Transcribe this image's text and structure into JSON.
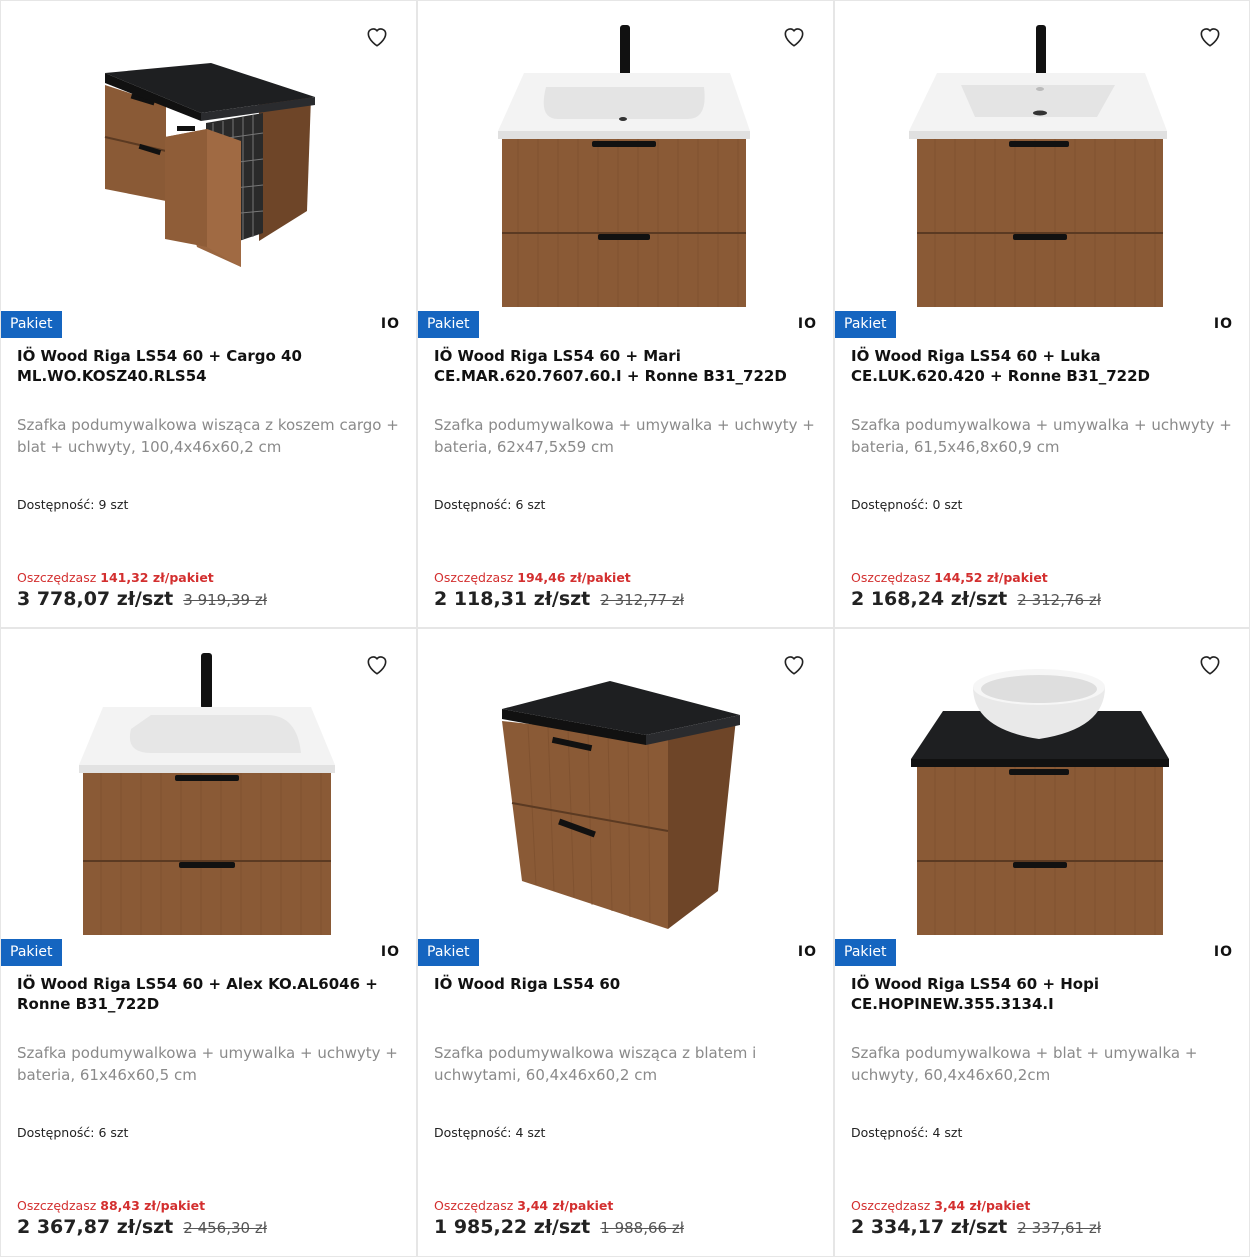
{
  "badge_label": "Pakiet",
  "brand_label": "IO",
  "availability_label": "Dostępność:",
  "save_label": "Oszczędzasz",
  "colors": {
    "badge": "#1565c0",
    "save": "#d32f2f",
    "wood": "#8a5a36",
    "countertop": "#1e1f21",
    "basin": "#f1f1f1"
  },
  "products": [
    {
      "title": "IÖ Wood Riga LS54 60 + Cargo 40 ML.WO.KOSZ40.RLS54",
      "description": "Szafka podumywalkowa wisząca z koszem cargo + blat + uchwyty, 100,4x46x60,2 cm",
      "availability": "9 szt",
      "savings": "141,32 zł/pakiet",
      "price": "3 778,07 zł/szt",
      "old_price": "3 919,39 zł",
      "image": "cabinet-cargo-image"
    },
    {
      "title": "IÖ Wood Riga LS54 60 + Mari CE.MAR.620.7607.60.I + Ronne B31_722D",
      "description": "Szafka podumywalkowa + umywalka + uchwyty + bateria, 62x47,5x59 cm",
      "availability": "6 szt",
      "savings": "194,46 zł/pakiet",
      "price": "2 118,31 zł/szt",
      "old_price": "2 312,77 zł",
      "image": "cabinet-basin-faucet-image"
    },
    {
      "title": "IÖ Wood Riga LS54 60 + Luka CE.LUK.620.420 + Ronne B31_722D",
      "description": "Szafka podumywalkowa + umywalka + uchwyty + bateria, 61,5x46,8x60,9 cm",
      "availability": "0 szt",
      "savings": "144,52 zł/pakiet",
      "price": "2 168,24 zł/szt",
      "old_price": "2 312,76 zł",
      "image": "cabinet-basin-faucet-image"
    },
    {
      "title": "IÖ Wood Riga LS54 60 + Alex KO.AL6046 + Ronne B31_722D",
      "description": "Szafka podumywalkowa + umywalka + uchwyty + bateria, 61x46x60,5 cm",
      "availability": "6 szt",
      "savings": "88,43 zł/pakiet",
      "price": "2 367,87 zł/szt",
      "old_price": "2 456,30 zł",
      "image": "cabinet-basin-faucet-image"
    },
    {
      "title": "IÖ Wood Riga LS54 60",
      "description": "Szafka podumywalkowa wisząca z blatem i uchwytami, 60,4x46x60,2 cm",
      "availability": "4 szt",
      "savings": "3,44 zł/pakiet",
      "price": "1 985,22 zł/szt",
      "old_price": "1 988,66 zł",
      "image": "cabinet-countertop-image"
    },
    {
      "title": "IÖ Wood Riga LS54 60 + Hopi CE.HOPINEW.355.3134.I",
      "description": "Szafka podumywalkowa + blat + umywalka + uchwyty, 60,4x46x60,2cm",
      "availability": "4 szt",
      "savings": "3,44 zł/pakiet",
      "price": "2 334,17 zł/szt",
      "old_price": "2 337,61 zł",
      "image": "cabinet-vessel-basin-image"
    }
  ]
}
